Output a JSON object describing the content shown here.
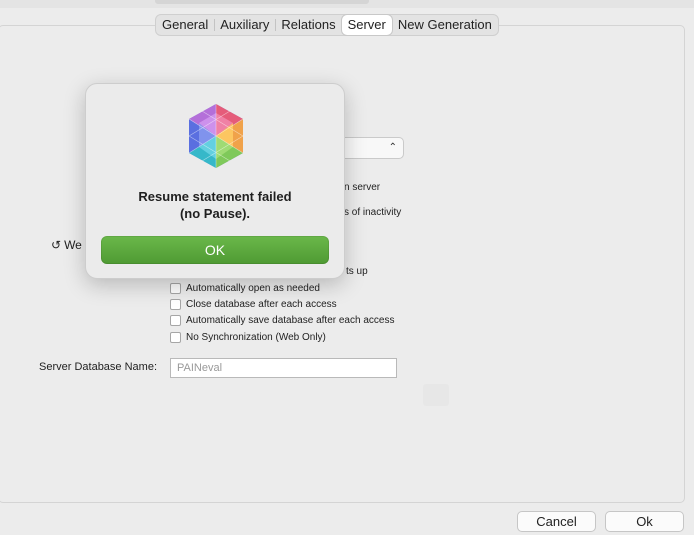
{
  "tabs": [
    {
      "label": "General",
      "active": false
    },
    {
      "label": "Auxiliary",
      "active": false
    },
    {
      "label": "Relations",
      "active": false
    },
    {
      "label": "Server",
      "active": true
    },
    {
      "label": "New Generation",
      "active": false
    }
  ],
  "server": {
    "hidden_fragments": {
      "server_tail": "n server",
      "inactivity_tail": "s of inactivity",
      "starts_up_tail": "ts up",
      "reload_label": "We"
    },
    "checkboxes": [
      {
        "label": "Automatically open as needed",
        "checked": false
      },
      {
        "label": "Close database after each access",
        "checked": false
      },
      {
        "label": "Automatically save database after each access",
        "checked": false
      },
      {
        "label": "No Synchronization (Web Only)",
        "checked": false
      }
    ],
    "db_name_label": "Server Database Name:",
    "db_name_placeholder": "PAINeval"
  },
  "footer": {
    "cancel": "Cancel",
    "ok": "Ok"
  },
  "alert": {
    "line1": "Resume statement failed",
    "line2": "(no Pause).",
    "ok": "OK",
    "icon": "multicolor-hexagon-app-icon"
  }
}
